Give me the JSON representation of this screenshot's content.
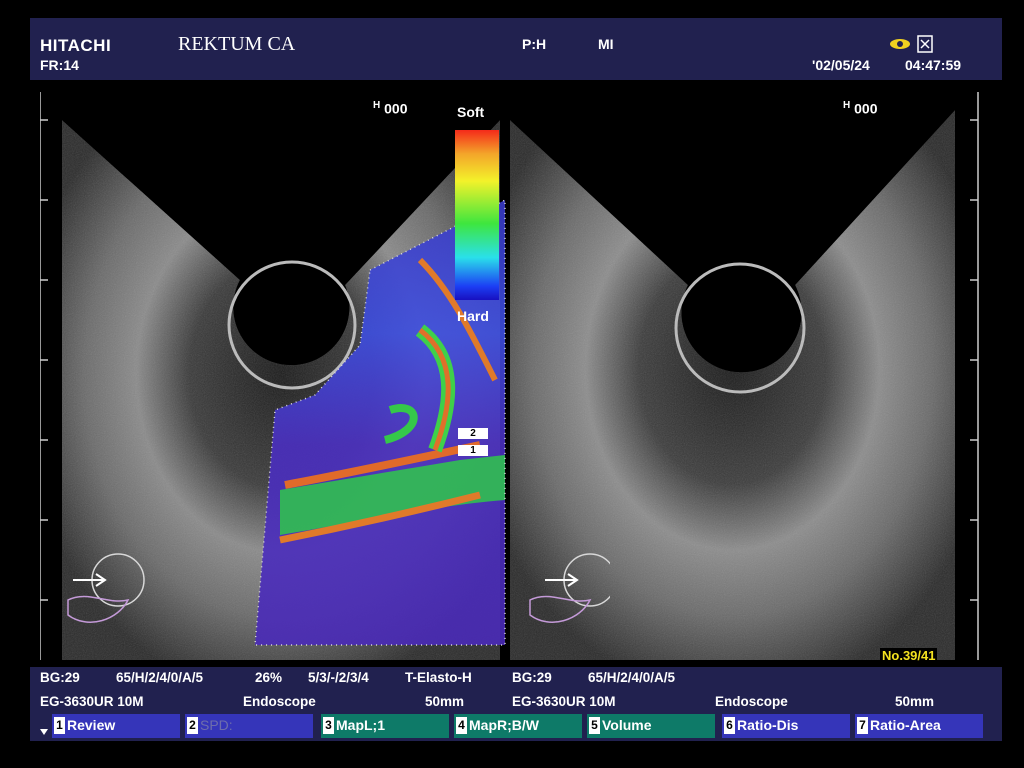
{
  "header": {
    "brand": "HITACHI",
    "frame_rate": "FR:14",
    "title": "REKTUM CA",
    "probe_mode": "P:H",
    "mi": "MI",
    "date": "'02/05/24",
    "time": "04:47:59"
  },
  "image": {
    "left_depth": "000",
    "right_depth": "000",
    "depth_prefix": "H",
    "colorbar_top": "Soft",
    "colorbar_bottom": "Hard",
    "roi_marker_2": "2",
    "roi_marker_1": "1",
    "frame_counter": "No.39/41"
  },
  "info_row1": {
    "bg_left": "BG:29",
    "params_left": "65/H/2/4/0/A/5",
    "percent": "26%",
    "elasto_params": "5/3/-/2/3/4",
    "mode": "T-Elasto-H",
    "bg_right": "BG:29",
    "params_right": "65/H/2/4/0/A/5"
  },
  "info_row2": {
    "probe_left": "EG-3630UR 10M",
    "type_left": "Endoscope",
    "depth_left": "50mm",
    "probe_right": "EG-3630UR 10M",
    "type_right": "Endoscope",
    "depth_right": "50mm"
  },
  "softkeys": [
    {
      "num": "1",
      "label": "Review"
    },
    {
      "num": "2",
      "label": "SPD:"
    },
    {
      "num": "3",
      "label": "MapL;1"
    },
    {
      "num": "4",
      "label": "MapR;B/W"
    },
    {
      "num": "5",
      "label": "Volume"
    },
    {
      "num": "6",
      "label": "Ratio-Dis"
    },
    {
      "num": "7",
      "label": "Ratio-Area"
    }
  ],
  "colors": {
    "panel": "#21214f",
    "button_blue": "#3535b9",
    "button_teal": "#0e7a68",
    "counter_yellow": "#f3e21f"
  }
}
